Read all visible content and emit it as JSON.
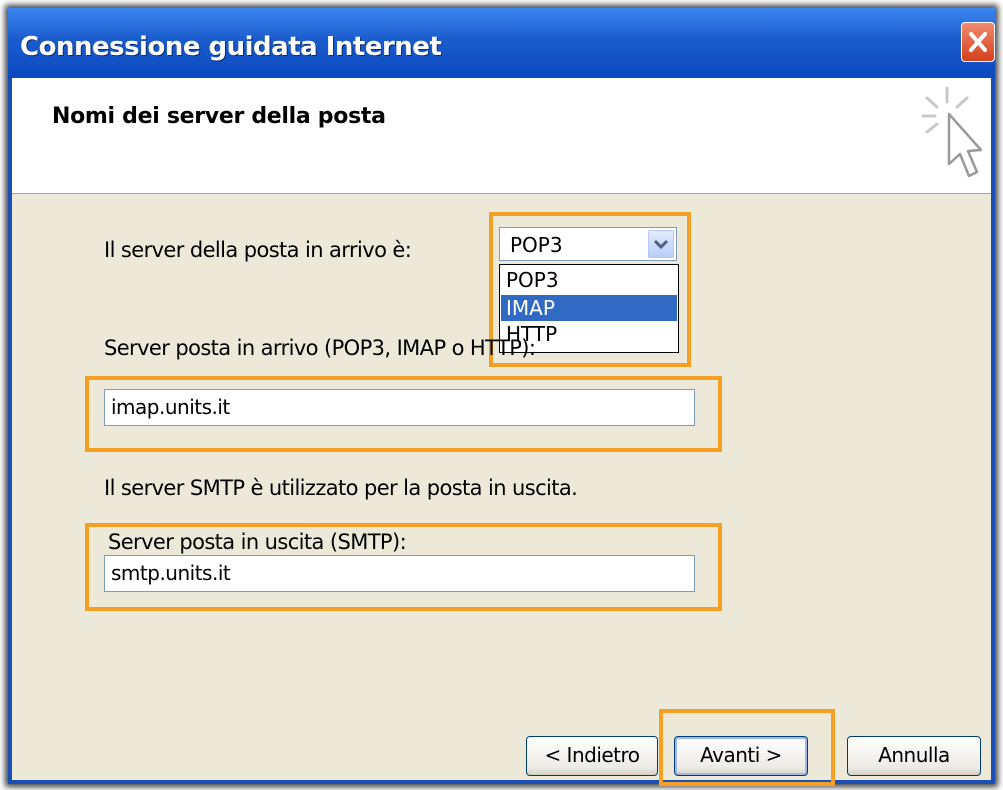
{
  "window": {
    "title": "Connessione guidata Internet"
  },
  "page": {
    "heading": "Nomi dei server della posta"
  },
  "incoming_type": {
    "label": "Il server della posta in arrivo è:",
    "selected": "POP3",
    "options": [
      "POP3",
      "IMAP",
      "HTTP"
    ],
    "highlighted_option": "IMAP"
  },
  "incoming_server": {
    "label": "Server posta in arrivo (POP3, IMAP o HTTP):",
    "value": "imap.units.it"
  },
  "smtp_info": "Il server SMTP è utilizzato per la posta in uscita.",
  "outgoing_server": {
    "label": "Server posta in uscita (SMTP):",
    "value": "smtp.units.it"
  },
  "buttons": {
    "back": "< Indietro",
    "next": "Avanti >",
    "cancel": "Annulla"
  },
  "colors": {
    "highlight": "#f5a023",
    "titlebar": "#0a48c0",
    "selection": "#316ac5"
  },
  "icons": {
    "close": "close-icon",
    "wizard": "cursor-sparkle-icon",
    "dropdown": "chevron-down-icon"
  }
}
